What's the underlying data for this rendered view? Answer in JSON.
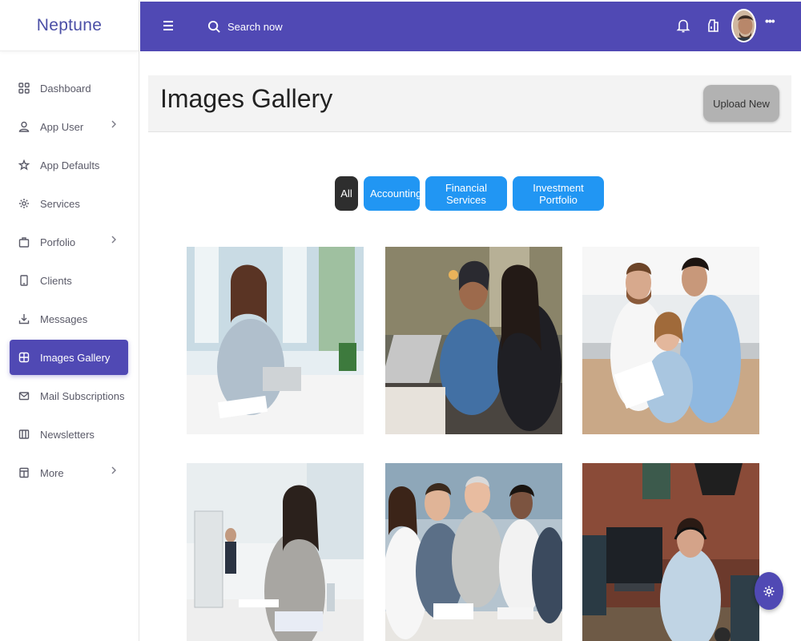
{
  "app": {
    "brand": "Neptune"
  },
  "sidebar": {
    "items": [
      {
        "label": "Dashboard",
        "icon": "grid-icon",
        "has_chevron": false,
        "active": false
      },
      {
        "label": "App User",
        "icon": "user-icon",
        "has_chevron": true,
        "active": false
      },
      {
        "label": "App Defaults",
        "icon": "star-icon",
        "has_chevron": false,
        "active": false
      },
      {
        "label": "Services",
        "icon": "gear-icon",
        "has_chevron": false,
        "active": false
      },
      {
        "label": "Porfolio",
        "icon": "briefcase-icon",
        "has_chevron": true,
        "active": false
      },
      {
        "label": "Clients",
        "icon": "tablet-icon",
        "has_chevron": false,
        "active": false
      },
      {
        "label": "Messages",
        "icon": "download-icon",
        "has_chevron": false,
        "active": false
      },
      {
        "label": "Images Gallery",
        "icon": "gallery-icon",
        "has_chevron": false,
        "active": true
      },
      {
        "label": "Mail Subscriptions",
        "icon": "mail-icon",
        "has_chevron": false,
        "active": false
      },
      {
        "label": "Newsletters",
        "icon": "columns-icon",
        "has_chevron": false,
        "active": false
      },
      {
        "label": "More",
        "icon": "layout-icon",
        "has_chevron": true,
        "active": false
      }
    ]
  },
  "topbar": {
    "search_placeholder": "Search now",
    "icons": [
      "menu-icon",
      "search-icon",
      "bell-icon",
      "cube-icon",
      "avatar",
      "more-dots-icon"
    ],
    "more_label": "•••"
  },
  "page": {
    "title": "Images Gallery",
    "upload_label": "Upload New"
  },
  "filters": [
    {
      "label": "All",
      "active": true
    },
    {
      "label": "Accounting",
      "active": false
    },
    {
      "label": "Financial Services",
      "active": false
    },
    {
      "label": "Investment Portfolio",
      "active": false
    }
  ],
  "gallery": {
    "photos": [
      {
        "name": "woman-writing-at-desk-photo"
      },
      {
        "name": "women-with-laptop-photo"
      },
      {
        "name": "team-reviewing-document-photo"
      },
      {
        "name": "woman-on-phone-at-computer-photo"
      },
      {
        "name": "business-meeting-photo"
      },
      {
        "name": "man-with-headset-photo"
      }
    ]
  },
  "colors": {
    "primary": "#5049b4",
    "filter_button": "#2196f3",
    "filter_active": "#2e2e2e",
    "upload_button": "#b2b2b2"
  }
}
